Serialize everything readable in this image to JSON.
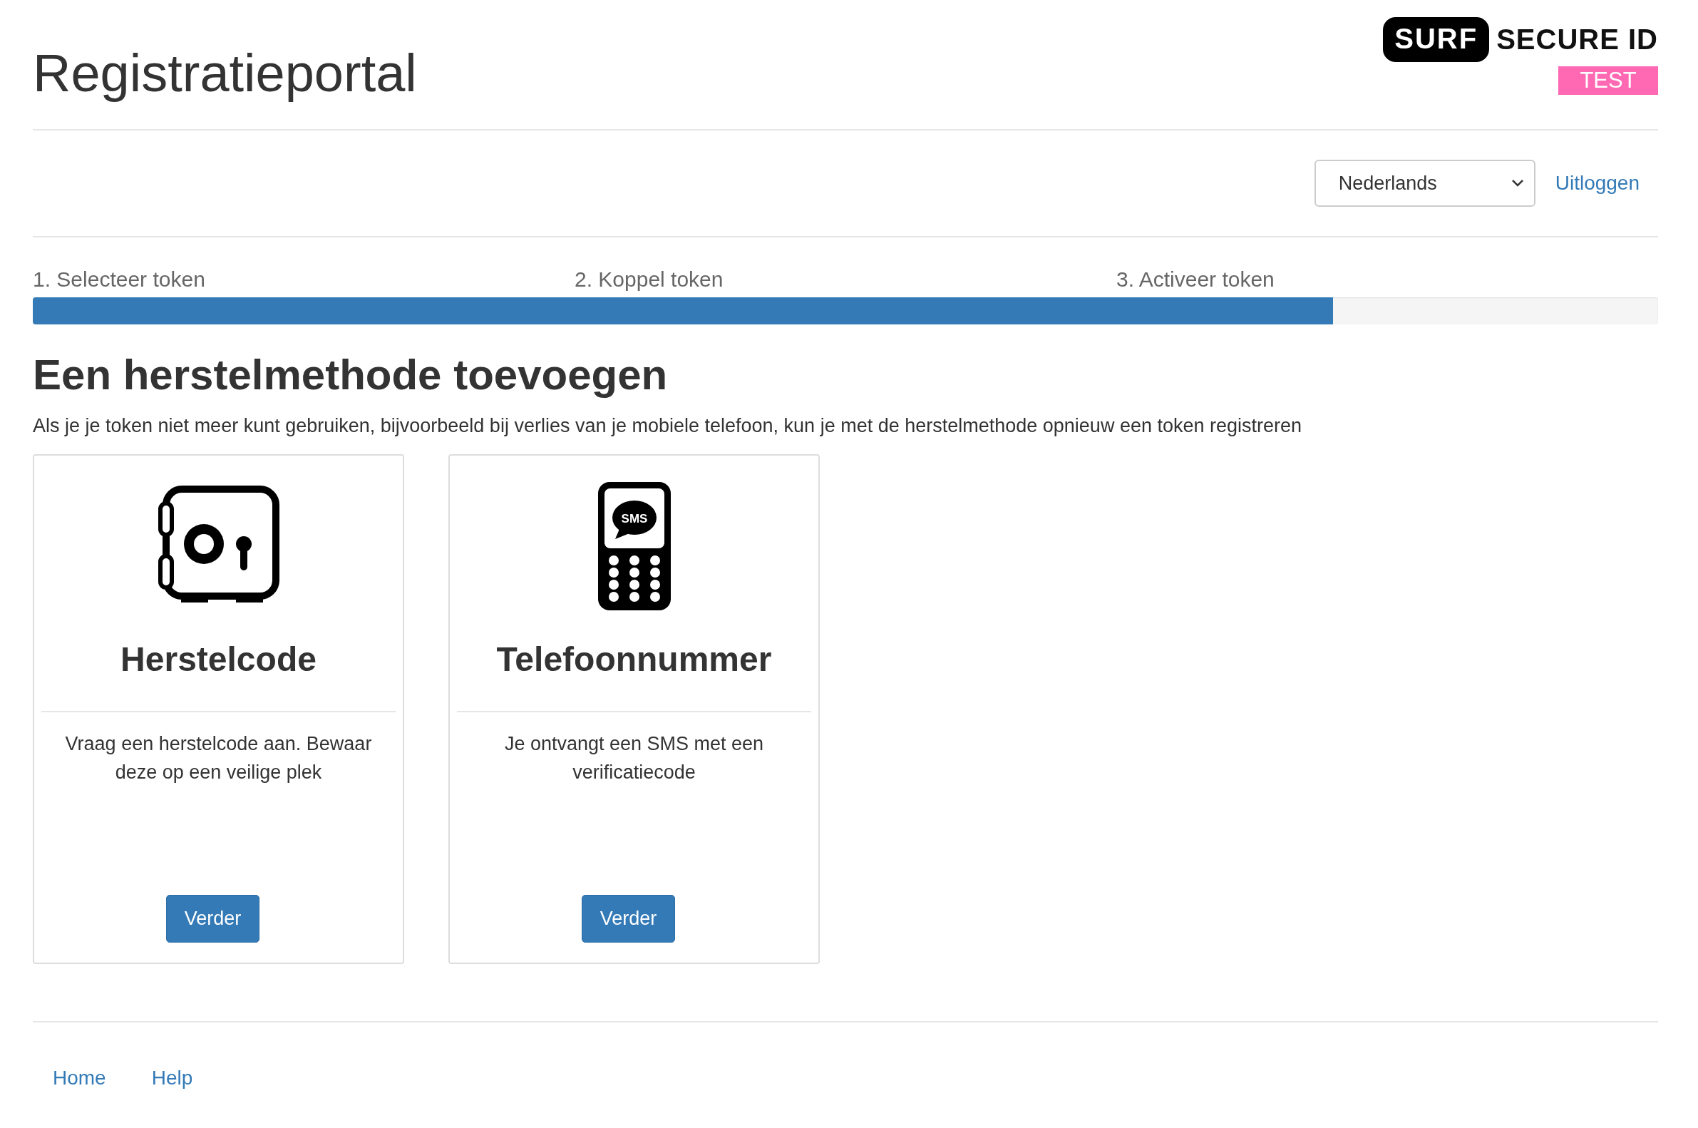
{
  "header": {
    "title": "Registratieportal",
    "logo": {
      "brand": "SURF",
      "product": "SECURE ID",
      "badge": "TEST"
    }
  },
  "toolbar": {
    "language": "Nederlands",
    "logout": "Uitloggen"
  },
  "steps": [
    {
      "label": "1. Selecteer token"
    },
    {
      "label": "2. Koppel token"
    },
    {
      "label": "3. Activeer token"
    }
  ],
  "progress": {
    "level": 0.8
  },
  "heading": "Een herstelmethode toevoegen",
  "intro": "Als je je token niet meer kunt gebruiken, bijvoorbeeld bij verlies van je mobiele telefoon, kun je met de herstelmethode opnieuw een token registreren",
  "cards": [
    {
      "kind": "safe",
      "title": "Herstelcode",
      "description": "Vraag een herstelcode aan. Bewaar deze op een veilige plek",
      "button": "Verder"
    },
    {
      "kind": "phone",
      "icon_text": "SMS",
      "title": "Telefoonnummer",
      "description": "Je ontvangt een SMS met een verificatiecode",
      "button": "Verder"
    }
  ],
  "footer": {
    "links": [
      "Home",
      "Help"
    ]
  }
}
